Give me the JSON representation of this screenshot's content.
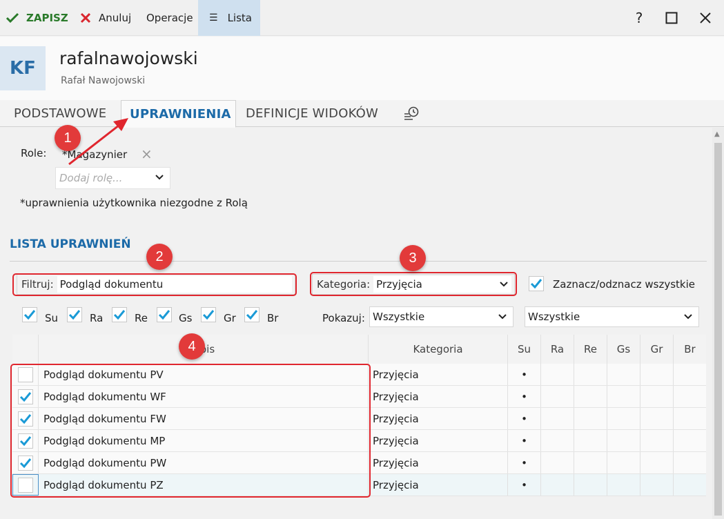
{
  "toolbar": {
    "save_label": "ZAPISZ",
    "cancel_label": "Anuluj",
    "operations_label": "Operacje",
    "list_label": "Lista",
    "help_label": "?"
  },
  "header": {
    "initials": "KF",
    "username": "rafalnawojowski",
    "fullname": "Rafał Nawojowski"
  },
  "tabs": {
    "basic": "PODSTAWOWE",
    "permissions": "UPRAWNIENIA",
    "views": "DEFINICJE WIDOKÓW"
  },
  "roles": {
    "label": "Role:",
    "assigned": "*Magazynier",
    "add_placeholder": "Dodaj rolę...",
    "note": "*uprawnienia użytkownika niezgodne z Rolą"
  },
  "permissions": {
    "section_title": "LISTA UPRAWNIEŃ",
    "filter_label": "Filtruj:",
    "filter_value": "Podgląd dokumentu",
    "category_label": "Kategoria:",
    "category_value": "Przyjęcia",
    "check_all_label": "Zaznacz/odznacz wszystkie",
    "flags": [
      "Su",
      "Ra",
      "Re",
      "Gs",
      "Gr",
      "Br"
    ],
    "show_label": "Pokazuj:",
    "show_value_1": "Wszystkie",
    "show_value_2": "Wszystkie"
  },
  "grid": {
    "columns": [
      "Opis",
      "Kategoria",
      "Su",
      "Ra",
      "Re",
      "Gs",
      "Gr",
      "Br"
    ],
    "rows": [
      {
        "checked": false,
        "name": "Podgląd dokumentu PV",
        "category": "Przyjęcia",
        "su": "•"
      },
      {
        "checked": true,
        "name": "Podgląd dokumentu WF",
        "category": "Przyjęcia",
        "su": "•"
      },
      {
        "checked": true,
        "name": "Podgląd dokumentu FW",
        "category": "Przyjęcia",
        "su": "•"
      },
      {
        "checked": true,
        "name": "Podgląd dokumentu MP",
        "category": "Przyjęcia",
        "su": "•"
      },
      {
        "checked": true,
        "name": "Podgląd dokumentu PW",
        "category": "Przyjęcia",
        "su": "•"
      },
      {
        "checked": false,
        "name": "Podgląd dokumentu PZ",
        "category": "Przyjęcia",
        "su": "•"
      }
    ]
  },
  "annotations": [
    "1",
    "2",
    "3",
    "4"
  ],
  "colors": {
    "accent": "#1c6aa8",
    "save_green": "#2a7a2a",
    "cancel_red": "#d9262e",
    "checkmark": "#1a9ad6",
    "annotation_red": "#e23a3a"
  }
}
